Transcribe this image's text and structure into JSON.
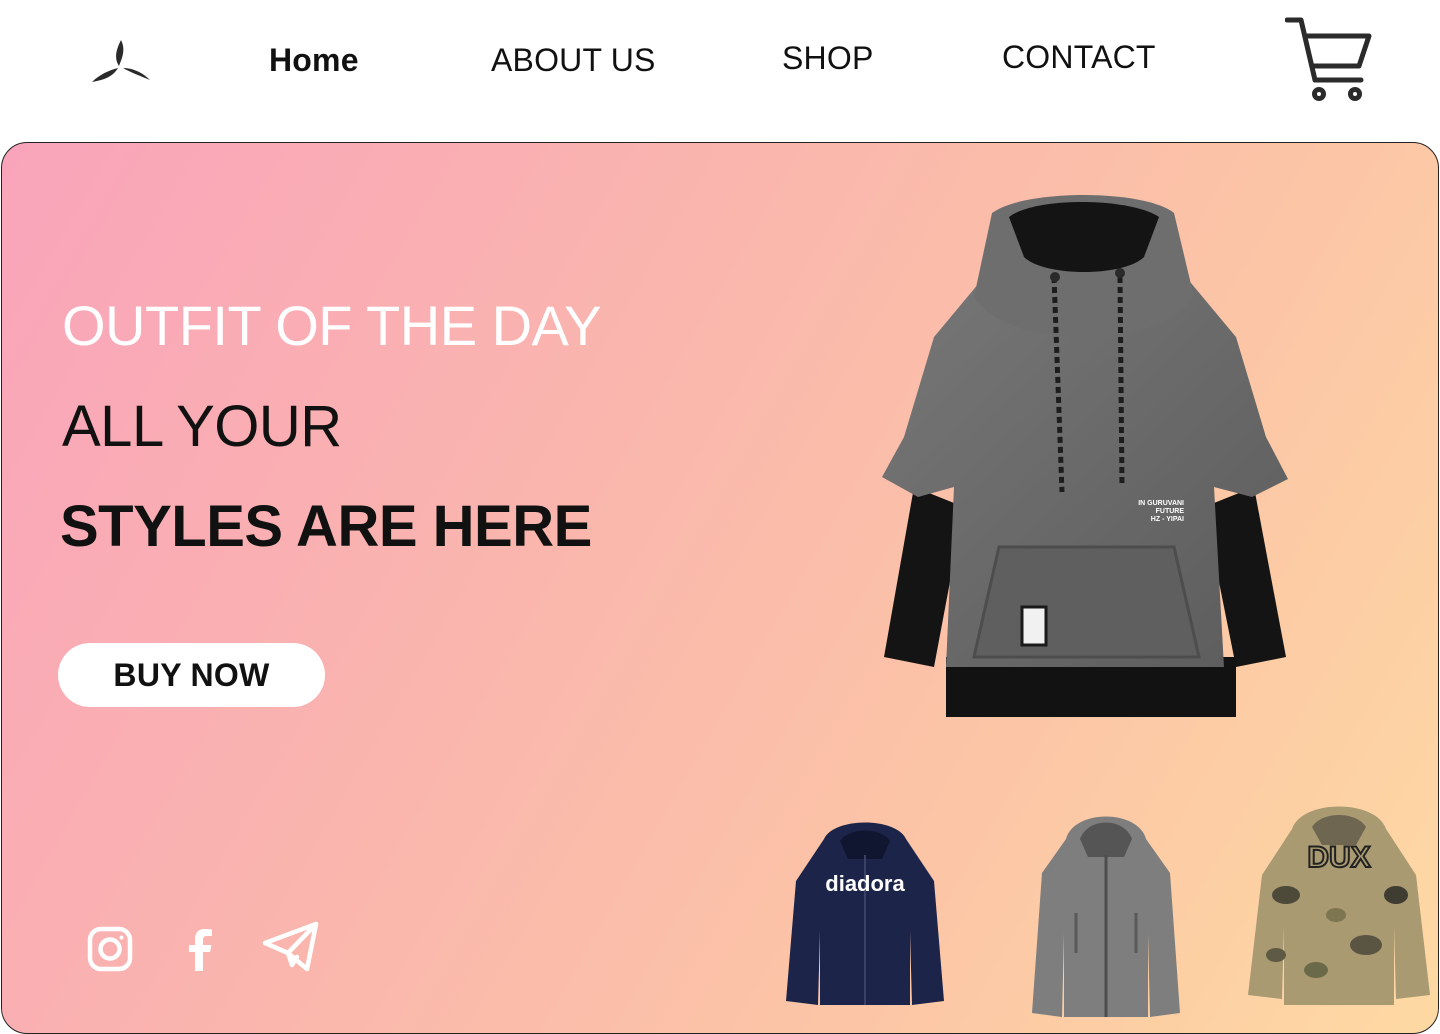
{
  "nav": {
    "items": [
      {
        "label": "Home",
        "active": true
      },
      {
        "label": "ABOUT US"
      },
      {
        "label": "SHOP"
      },
      {
        "label": "CONTACT"
      }
    ]
  },
  "icons": {
    "logo": "tri-blade-logo",
    "cart": "shopping-cart-icon",
    "social": [
      "instagram-icon",
      "facebook-icon",
      "telegram-icon"
    ]
  },
  "hero": {
    "title": "OUTFIT OF THE DAY",
    "line2": "ALL YOUR",
    "line3": "STYLES ARE HERE",
    "button_label": "BUY NOW",
    "gradient": [
      "#f9a4bb",
      "#fab6ad",
      "#fcc6a6",
      "#fed9a3"
    ],
    "featured_print": [
      "IN GURUVANI",
      "FUTURE",
      "HZ - YIPAI"
    ]
  },
  "thumbnails": [
    {
      "brand_text": "diadora",
      "color": "#1c2449"
    },
    {
      "color": "#808080"
    },
    {
      "brand_text": "DUX",
      "color": "#a99a72"
    }
  ]
}
